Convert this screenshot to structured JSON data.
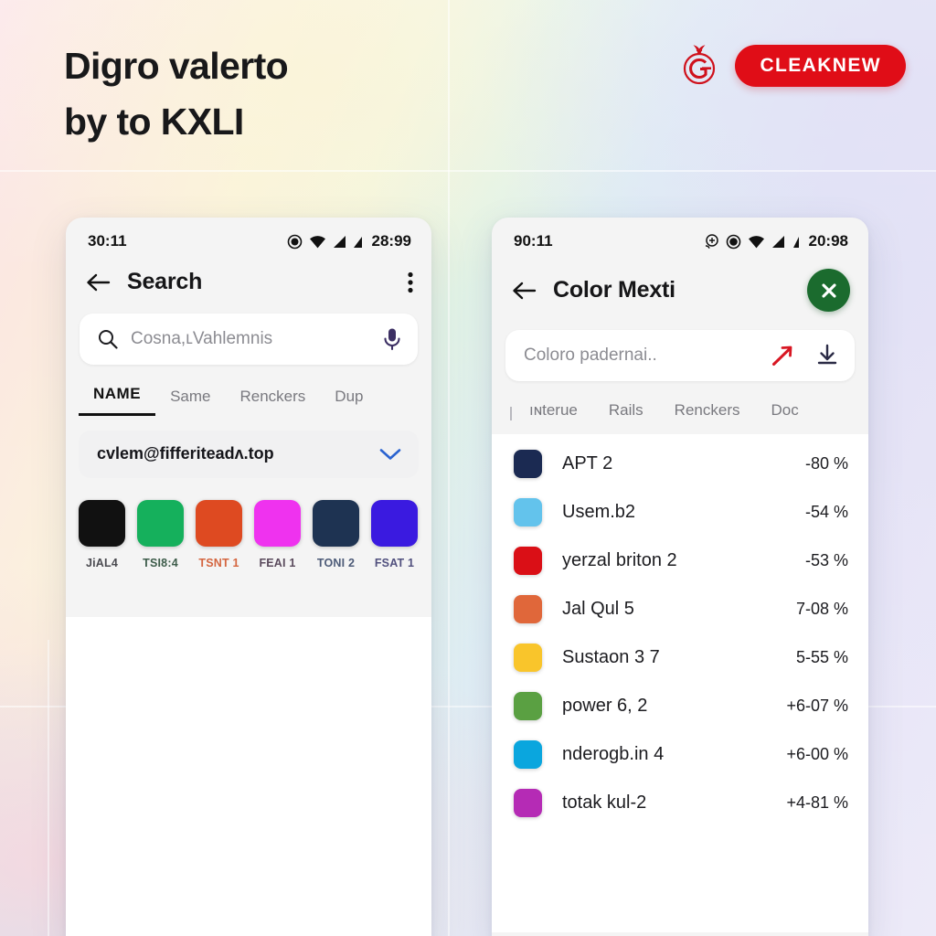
{
  "hero": {
    "line1": "Digro valerto",
    "line2": "by to KXLI"
  },
  "brand": {
    "logo_icon": "pomegranate-g-logo-icon",
    "pill_label": "CLEAKNEW",
    "pill_color": "#e00d17"
  },
  "phone_left": {
    "status": {
      "time_left": "30:11",
      "time_right": "28:99",
      "icons": [
        "alarm-icon",
        "wifi-icon",
        "signal-icon",
        "signal-two-icon"
      ]
    },
    "appbar": {
      "back_icon": "back-arrow-icon",
      "title": "Search",
      "overflow_icon": "overflow-menu-icon"
    },
    "search": {
      "leading_icon": "search-icon",
      "placeholder": "Cosna,ʟVahlemnis",
      "trailing_icon": "microphone-icon"
    },
    "tabs": [
      {
        "label": "NAME",
        "active": true
      },
      {
        "label": "Same",
        "active": false
      },
      {
        "label": "Renckers",
        "active": false
      },
      {
        "label": "Dup",
        "active": false
      }
    ],
    "dropdown": {
      "value": "cvlem@fifferiteadʌ.top",
      "chevron_icon": "chevron-down-icon",
      "chevron_color": "#2a63d0"
    },
    "swatches": [
      {
        "label": "JiAL4",
        "color": "#111111",
        "label_color": "#4a4a50"
      },
      {
        "label": "TSI8:4",
        "color": "#15b05c",
        "label_color": "#3d5c4a"
      },
      {
        "label": "TSNT 1",
        "color": "#de4a21",
        "label_color": "#d4653f"
      },
      {
        "label": "FEAI 1",
        "color": "#ef32ef",
        "label_color": "#5a4a5c"
      },
      {
        "label": "TONI 2",
        "color": "#1e3352",
        "label_color": "#4d5b78"
      },
      {
        "label": "FSAT 1",
        "color": "#3a1ae0",
        "label_color": "#51507e"
      }
    ]
  },
  "phone_right": {
    "status": {
      "time_left": "90:11",
      "time_right": "20:98",
      "icons": [
        "cast-icon",
        "alarm-icon",
        "wifi-icon",
        "signal-icon",
        "signal-two-icon"
      ]
    },
    "appbar": {
      "back_icon": "back-arrow-icon",
      "title": "Color Mexti",
      "close_icon": "close-x-icon",
      "close_color": "#1b6b2e"
    },
    "search": {
      "placeholder": "Coloro padernai..",
      "trailing_icon_1": "trend-up-arrow-icon",
      "trailing_icon_1_color": "#d81723",
      "trailing_icon_2": "download-icon",
      "trailing_icon_2_color": "#2b2b46"
    },
    "tabs": [
      {
        "label": "ıɴterue",
        "active": false
      },
      {
        "label": "Rails",
        "active": false
      },
      {
        "label": "Renckers",
        "active": false
      },
      {
        "label": "Doc",
        "active": false
      }
    ],
    "rows": [
      {
        "color": "#1b2a52",
        "name": "APT 2",
        "value": "-80 %"
      },
      {
        "color": "#63c3ec",
        "name": "Usem.b2",
        "value": "-54 %"
      },
      {
        "color": "#da0f16",
        "name": "yerzal briton 2",
        "value": "-53 %"
      },
      {
        "color": "#e0673a",
        "name": "Jal Qul 5",
        "value": "7-08 %"
      },
      {
        "color": "#f9c52b",
        "name": "Sustaon 3 7",
        "value": "5-55 %"
      },
      {
        "color": "#5aa042",
        "name": "power 6, 2",
        "value": "+6-07 %"
      },
      {
        "color": "#0aa6de",
        "name": "nderogb.in 4",
        "value": "+6-00 %"
      },
      {
        "color": "#b52bb5",
        "name": "totak kul-2",
        "value": "+4-81 %"
      }
    ]
  }
}
